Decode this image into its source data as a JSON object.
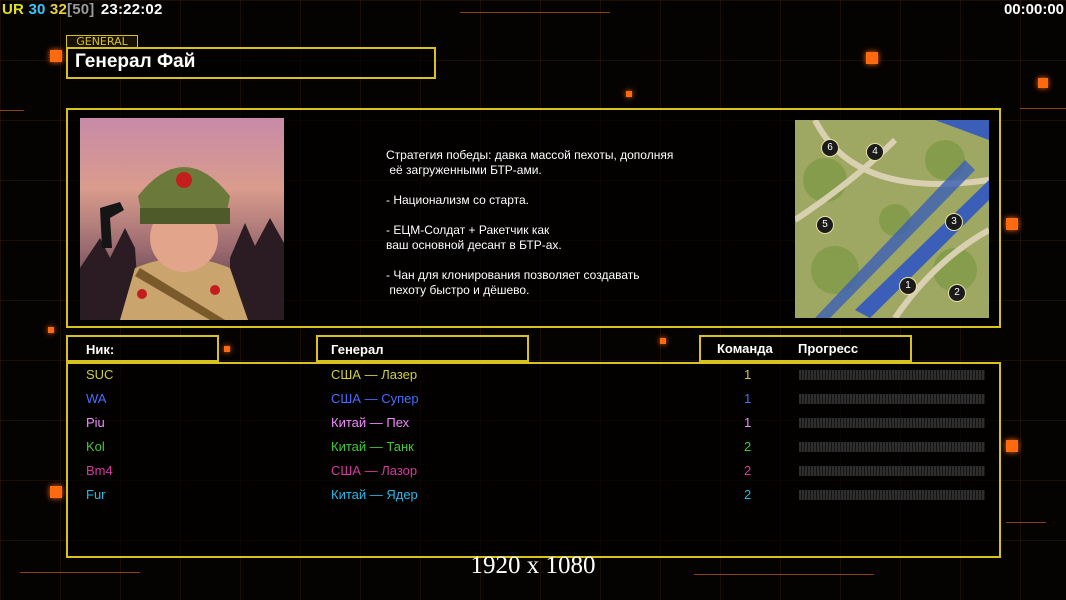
{
  "hud": {
    "ur": "UR",
    "num1": "30",
    "num2": "32",
    "bracket": "[50]",
    "clock": "23:22:02",
    "timer": "00:00:00"
  },
  "general": {
    "tag": "GENERAL",
    "name": "Генерал Фай",
    "strategy": "Стратегия победы: давка массой пехоты, дополняя\n её загруженными БТР-ами.\n\n- Национализм со старта.\n\n- ЕЦМ-Солдат + Ракетчик как\nваш основной десант в БТР-ах.\n\n- Чан для клонирования позволяет создавать\n пехоту быстро и дёшево."
  },
  "map_labels": [
    "6",
    "4",
    "5",
    "3",
    "1",
    "2"
  ],
  "table": {
    "headers": {
      "nick": "Ник:",
      "general": "Генерал",
      "team": "Команда",
      "progress": "Прогресс"
    },
    "rows": [
      {
        "nick": "SUC",
        "general": "США — Лазер",
        "team": "1",
        "progress": 0,
        "color": "#cfcf3a"
      },
      {
        "nick": "WA",
        "general": "США — Супер",
        "team": "1",
        "progress": 0,
        "color": "#4a6cff"
      },
      {
        "nick": "Piu",
        "general": "Китай — Пех",
        "team": "1",
        "progress": 0,
        "color": "#f08cff"
      },
      {
        "nick": "Kol",
        "general": "Китай — Танк",
        "team": "2",
        "progress": 0,
        "color": "#41c93a"
      },
      {
        "nick": "Bm4",
        "general": "США — Лазор",
        "team": "2",
        "progress": 0,
        "color": "#d63aa0"
      },
      {
        "nick": "Fur",
        "general": "Китай — Ядер",
        "team": "2",
        "progress": 0,
        "color": "#28b8e8"
      }
    ]
  },
  "colors": {
    "accent_yellow": "#d8c21b",
    "ur": "#e0e020",
    "num1": "#35c8ff",
    "num2": "#e6d23a",
    "bracket": "#9a9a9a"
  },
  "watermark": "1920 x 1080"
}
